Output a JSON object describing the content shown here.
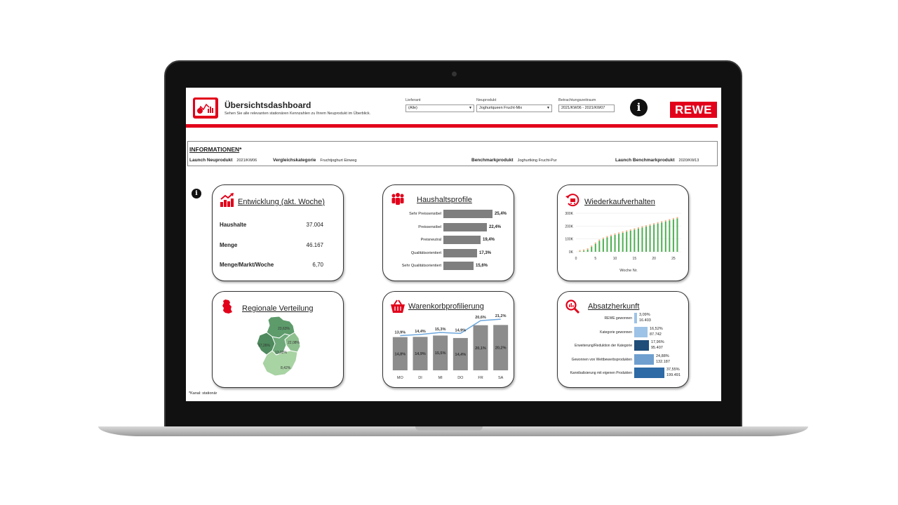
{
  "header": {
    "title": "Übersichtsdashboard",
    "subtitle": "Sehen Sie alle relevanten stationären Kennzahlen zu Ihrem Neuprodukt im Überblick.",
    "filters": [
      {
        "label": "Lieferant",
        "value": "(Alle)"
      },
      {
        "label": "Neuprodukt",
        "value": "Joghurtqueen Frucht-Mix"
      },
      {
        "label": "Betrachtungszeitraum",
        "value": "2021/KW06 - 2021/KW07"
      }
    ],
    "info_symbol": "i",
    "brand": "REWE"
  },
  "info": {
    "title": "INFORMATIONEN",
    "title_star": "*",
    "launch_label": "Launch Neuprodukt",
    "launch_value": "2021/KW06",
    "category_label": "Vergleichskategorie",
    "category_value": "Fruchtjoghurt Einweg",
    "benchmark_label": "Benchmarkprodukt",
    "benchmark_value": "Joghurtking Frucht-Pur",
    "benchmark_launch_label": "Launch Benchmarkprodukt",
    "benchmark_launch_value": "2020/KW13"
  },
  "info_symbol_small": "i",
  "cards": {
    "entwicklung": {
      "title": "Entwicklung (akt. Woche)",
      "rows": [
        {
          "label": "Haushalte",
          "value": "37.004"
        },
        {
          "label": "Menge",
          "value": "46.167"
        },
        {
          "label": "Menge/Markt/Woche",
          "value": "6,70"
        }
      ]
    },
    "haushaltsprofile": {
      "title": "Haushaltsprofile",
      "bars": [
        {
          "label": "Sehr Preissensibel",
          "value": 25.4,
          "text": "25,4%"
        },
        {
          "label": "Preissensibel",
          "value": 22.4,
          "text": "22,4%"
        },
        {
          "label": "Preisneutral",
          "value": 19.4,
          "text": "19,4%"
        },
        {
          "label": "Qualitätsorientiert",
          "value": 17.3,
          "text": "17,3%"
        },
        {
          "label": "Sehr Qualitätsorientiert",
          "value": 15.6,
          "text": "15,6%"
        }
      ]
    },
    "wiederkauf": {
      "title": "Wiederkaufverhalten",
      "xlabel": "Woche Nr.",
      "yticks": [
        "0K",
        "100K",
        "200K",
        "300K"
      ],
      "xticks": [
        "0",
        "5",
        "10",
        "15",
        "20",
        "25"
      ]
    },
    "regional": {
      "title": "Regionale Verteilung",
      "labels": [
        "23,63%",
        "17,26%",
        "22,08%",
        "13,02%",
        "8,42%"
      ]
    },
    "warenkorb": {
      "title": "Warenkorbprofilierung",
      "days": [
        "MO",
        "DI",
        "MI",
        "DO",
        "FR",
        "SA"
      ],
      "line_text": [
        "13,9%",
        "14,4%",
        "15,3%",
        "14,9%",
        "20,6%",
        "21,2%"
      ],
      "bar_text": [
        "14,8%",
        "14,9%",
        "15,5%",
        "14,4%",
        "20,1%",
        "20,2%"
      ]
    },
    "absatz": {
      "title": "Absatzherkunft",
      "bars": [
        {
          "label": "REWE gewonnen",
          "pct": "3,09%",
          "abs": "16.403",
          "value": 3.09,
          "color": "#9dc3e6"
        },
        {
          "label": "Kategorie gewonnen",
          "pct": "16,52%",
          "abs": "87.742",
          "value": 16.52,
          "color": "#9dc3e6"
        },
        {
          "label": "Erweiterung/Reduktion der Kategorie",
          "pct": "17,96%",
          "abs": "95.407",
          "value": 17.96,
          "color": "#1f4e79"
        },
        {
          "label": "Gewonnen von Wettbewerbsprodukten",
          "pct": "24,88%",
          "abs": "132.187",
          "value": 24.88,
          "color": "#6f9fcf"
        },
        {
          "label": "Kannibalisierung mit eigenen Produkten",
          "pct": "37,55%",
          "abs": "199.491",
          "value": 37.55,
          "color": "#2e6aa5"
        }
      ]
    }
  },
  "footnote": "*Kanal: stationär",
  "chart_data": [
    {
      "type": "bar",
      "title": "Haushaltsprofile",
      "categories": [
        "Sehr Preissensibel",
        "Preissensibel",
        "Preisneutral",
        "Qualitätsorientiert",
        "Sehr Qualitätsorientiert"
      ],
      "values": [
        25.4,
        22.4,
        19.4,
        17.3,
        15.6
      ]
    },
    {
      "type": "bar",
      "title": "Wiederkaufverhalten",
      "xlabel": "Woche Nr.",
      "ylim": [
        0,
        300000
      ],
      "x": [
        1,
        2,
        3,
        4,
        5,
        6,
        7,
        8,
        9,
        10,
        11,
        12,
        13,
        14,
        15,
        16,
        17,
        18,
        19,
        20,
        21,
        22,
        23,
        24,
        25,
        26
      ],
      "values": [
        3000,
        8000,
        17000,
        38000,
        62000,
        85000,
        100000,
        112000,
        122000,
        132000,
        140000,
        148000,
        156000,
        164000,
        172000,
        180000,
        188000,
        196000,
        204000,
        212000,
        220000,
        228000,
        236000,
        244000,
        252000,
        260000
      ]
    },
    {
      "type": "bar",
      "title": "Warenkorbprofilierung",
      "categories": [
        "MO",
        "DI",
        "MI",
        "DO",
        "FR",
        "SA"
      ],
      "series": [
        {
          "values": [
            14.8,
            14.9,
            15.5,
            14.4,
            20.1,
            20.2
          ]
        },
        {
          "values": [
            13.9,
            14.4,
            15.3,
            14.9,
            20.6,
            21.2
          ]
        }
      ]
    },
    {
      "type": "bar",
      "title": "Absatzherkunft",
      "categories": [
        "REWE gewonnen",
        "Kategorie gewonnen",
        "Erweiterung/Reduktion der Kategorie",
        "Gewonnen von Wettbewerbsprodukten",
        "Kannibalisierung mit eigenen Produkten"
      ],
      "values": [
        3.09,
        16.52,
        17.96,
        24.88,
        37.55
      ]
    }
  ]
}
